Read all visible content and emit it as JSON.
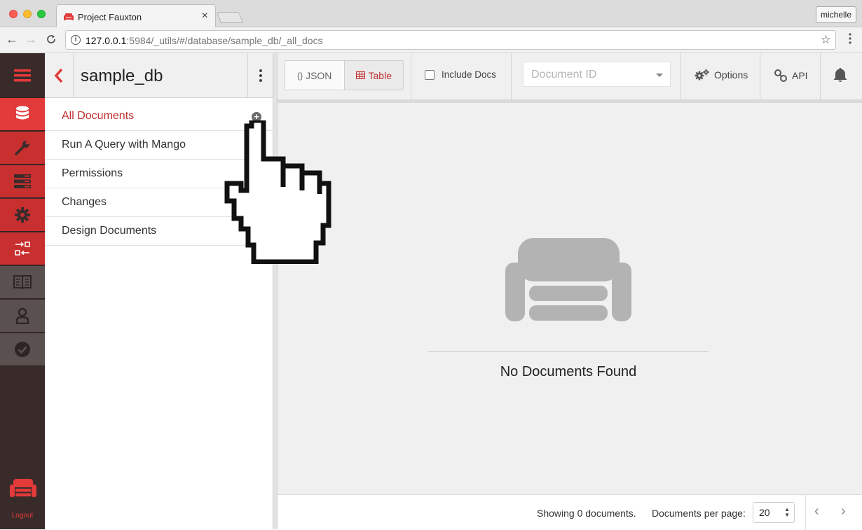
{
  "browser": {
    "tab_title": "Project Fauxton",
    "tab_close": "×",
    "profile_name": "michelle",
    "url_host": "127.0.0.1",
    "url_rest": ":5984/_utils/#/database/sample_db/_all_docs",
    "back": "←",
    "forward": "→",
    "reload": "C",
    "star": "☆",
    "menu": "⋮"
  },
  "leftnav": {
    "items": [
      {
        "icon": "menu-icon"
      },
      {
        "icon": "database-icon"
      },
      {
        "icon": "wrench-icon"
      },
      {
        "icon": "server-icon"
      },
      {
        "icon": "gear-icon"
      },
      {
        "icon": "replication-icon"
      },
      {
        "icon": "book-icon"
      },
      {
        "icon": "user-icon"
      },
      {
        "icon": "check-circle-icon"
      }
    ],
    "logout_label": "Logout"
  },
  "sidebar": {
    "db_name": "sample_db",
    "items": [
      {
        "label": "All Documents",
        "active": true
      },
      {
        "label": "Run A Query with Mango"
      },
      {
        "label": "Permissions"
      },
      {
        "label": "Changes"
      },
      {
        "label": "Design Documents"
      }
    ],
    "add_icon": "+"
  },
  "header": {
    "json_label": "JSON",
    "json_icon_text": "{}",
    "table_label": "Table",
    "include_docs_label": "Include Docs",
    "docid_placeholder": "Document ID",
    "options_label": "Options",
    "api_label": "API"
  },
  "main": {
    "empty_message": "No Documents Found"
  },
  "footer": {
    "showing": "Showing 0 documents.",
    "per_page_label": "Documents per page:",
    "per_page_value": "20",
    "prev": "‹",
    "next": "›"
  },
  "colors": {
    "accent_red": "#e33a3a",
    "dark_nav": "#3a2b2b",
    "active_text": "#c12f2f"
  }
}
